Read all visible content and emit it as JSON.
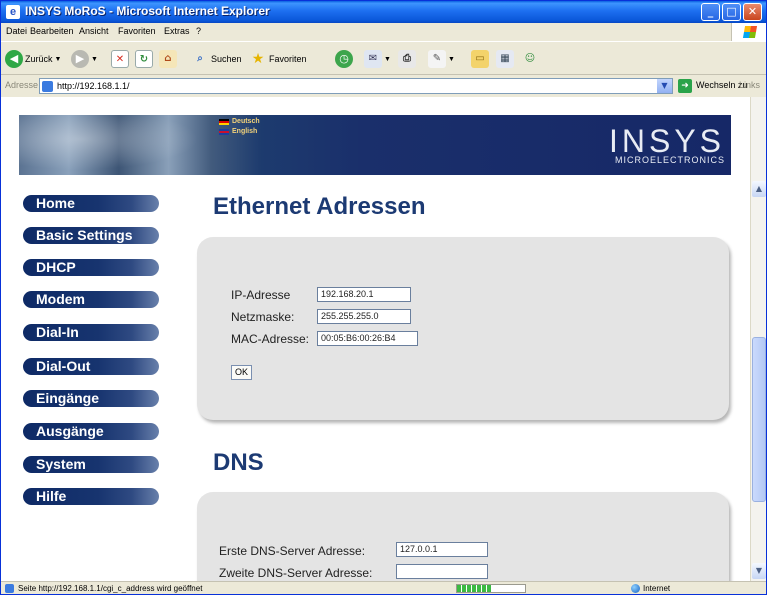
{
  "window": {
    "title": "INSYS MoRoS - Microsoft Internet Explorer"
  },
  "menubar": {
    "items": [
      "Datei",
      "Bearbeiten",
      "Ansicht",
      "Favoriten",
      "Extras",
      "?"
    ]
  },
  "toolbar": {
    "back_label": "Zurück",
    "search_label": "Suchen",
    "favorites_label": "Favoriten"
  },
  "addressbar": {
    "label": "Adresse",
    "url": "http://192.168.1.1/",
    "go_label": "Wechseln zu",
    "links_label": "Links"
  },
  "banner": {
    "lang_de": "Deutsch",
    "lang_en": "English",
    "logo_main": "INSYS",
    "logo_sub": "MICROELECTRONICS"
  },
  "nav": {
    "items": [
      "Home",
      "Basic Settings",
      "DHCP",
      "Modem",
      "Dial-In",
      "Dial-Out",
      "Eingänge",
      "Ausgänge",
      "System",
      "Hilfe"
    ]
  },
  "ethernet": {
    "heading": "Ethernet Adressen",
    "ip_label": "IP-Adresse",
    "ip_value": "192.168.20.1",
    "netmask_label": "Netzmaske:",
    "netmask_value": "255.255.255.0",
    "mac_label": "MAC-Adresse:",
    "mac_value": "00:05:B6:00:26:B4",
    "ok_label": "OK"
  },
  "dns": {
    "heading": "DNS",
    "first_label": "Erste DNS-Server Adresse:",
    "first_value": "127.0.0.1",
    "second_label": "Zweite DNS-Server Adresse:",
    "second_value": ""
  },
  "statusbar": {
    "text": "Seite http://192.168.1.1/cgi_c_address wird geöffnet",
    "zone": "Internet",
    "progress": 0.5
  },
  "colors": {
    "titlebar": "#0a56d8",
    "nav_button": "#0e2a66",
    "heading": "#1c3a73",
    "panel": "#e4e4e4"
  }
}
